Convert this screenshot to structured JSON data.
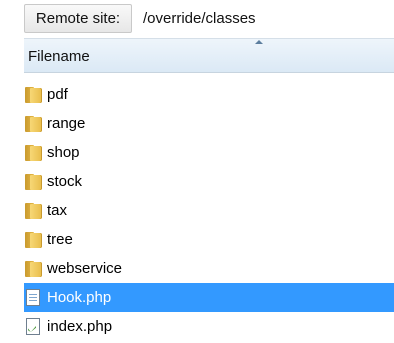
{
  "remote_site": {
    "label": "Remote site:",
    "path": "/override/classes"
  },
  "columns": {
    "filename": "Filename",
    "sort_icon": "sort-ascending-icon"
  },
  "files": [
    {
      "name": "pdf",
      "type": "folder",
      "icon": "folder-icon",
      "selected": false
    },
    {
      "name": "range",
      "type": "folder",
      "icon": "folder-icon",
      "selected": false
    },
    {
      "name": "shop",
      "type": "folder",
      "icon": "folder-icon",
      "selected": false
    },
    {
      "name": "stock",
      "type": "folder",
      "icon": "folder-icon",
      "selected": false
    },
    {
      "name": "tax",
      "type": "folder",
      "icon": "folder-icon",
      "selected": false
    },
    {
      "name": "tree",
      "type": "folder",
      "icon": "folder-icon",
      "selected": false
    },
    {
      "name": "webservice",
      "type": "folder",
      "icon": "folder-icon",
      "selected": false
    },
    {
      "name": "Hook.php",
      "type": "file",
      "icon": "php-file-icon",
      "selected": true
    },
    {
      "name": "index.php",
      "type": "file",
      "icon": "php-file-icon",
      "selected": false
    }
  ],
  "colors": {
    "selection": "#3399ff",
    "header_top": "#eef5fb",
    "header_bottom": "#dbe9f5",
    "folder": "#e8bd4a"
  }
}
